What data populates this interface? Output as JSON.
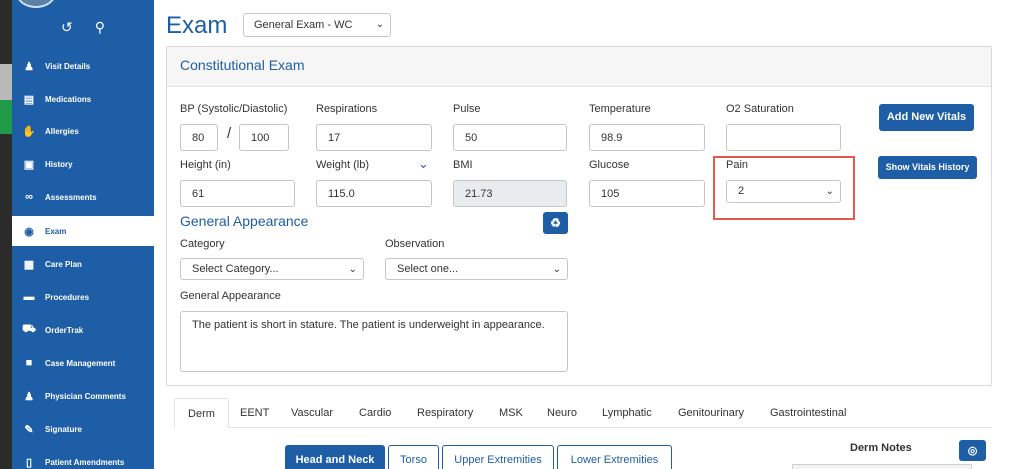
{
  "sidebar": {
    "items": [
      {
        "label": "Visit Details",
        "icon": "users-icon"
      },
      {
        "label": "Medications",
        "icon": "document-icon"
      },
      {
        "label": "Allergies",
        "icon": "hand-icon"
      },
      {
        "label": "History",
        "icon": "book-icon"
      },
      {
        "label": "Assessments",
        "icon": "glasses-icon"
      },
      {
        "label": "Exam",
        "icon": "eye-icon"
      },
      {
        "label": "Care Plan",
        "icon": "file-icon"
      },
      {
        "label": "Procedures",
        "icon": "bed-icon"
      },
      {
        "label": "OrderTrak",
        "icon": "truck-icon"
      },
      {
        "label": "Case Management",
        "icon": "briefcase-icon"
      },
      {
        "label": "Physician Comments",
        "icon": "user-icon"
      },
      {
        "label": "Signature",
        "icon": "signature-icon"
      },
      {
        "label": "Patient Amendments",
        "icon": "folder-icon"
      }
    ]
  },
  "header": {
    "title": "Exam",
    "exam_type": "General Exam - WC"
  },
  "panel": {
    "title": "Constitutional Exam",
    "vitals": {
      "bp_label": "BP (Systolic/Diastolic)",
      "bp_systolic": "80",
      "bp_separator": "/",
      "bp_diastolic": "100",
      "respirations_label": "Respirations",
      "respirations": "17",
      "pulse_label": "Pulse",
      "pulse": "50",
      "temperature_label": "Temperature",
      "temperature": "98.9",
      "o2_label": "O2 Saturation",
      "o2": "",
      "height_label": "Height (in)",
      "height": "61",
      "weight_label": "Weight (lb)",
      "weight": "115.0",
      "bmi_label": "BMI",
      "bmi": "21.73",
      "glucose_label": "Glucose",
      "glucose": "105",
      "pain_label": "Pain",
      "pain": "2"
    },
    "add_vitals_label": "Add New Vitals",
    "show_history_label": "Show Vitals History",
    "general_appearance": {
      "title": "General Appearance",
      "category_label": "Category",
      "category_placeholder": "Select Category...",
      "observation_label": "Observation",
      "observation_placeholder": "Select one...",
      "text_label": "General Appearance",
      "text": "The patient is short in stature. The patient is underweight in appearance."
    }
  },
  "tabs": [
    "Derm",
    "EENT",
    "Vascular",
    "Cardio",
    "Respiratory",
    "MSK",
    "Neuro",
    "Lymphatic",
    "Genitourinary",
    "Gastrointestinal"
  ],
  "subtabs": [
    "Head and Neck",
    "Torso",
    "Upper Extremities",
    "Lower Extremities"
  ],
  "derm_notes_label": "Derm Notes",
  "colors": {
    "primary": "#1e5ea6",
    "highlight": "#e05a4e"
  }
}
